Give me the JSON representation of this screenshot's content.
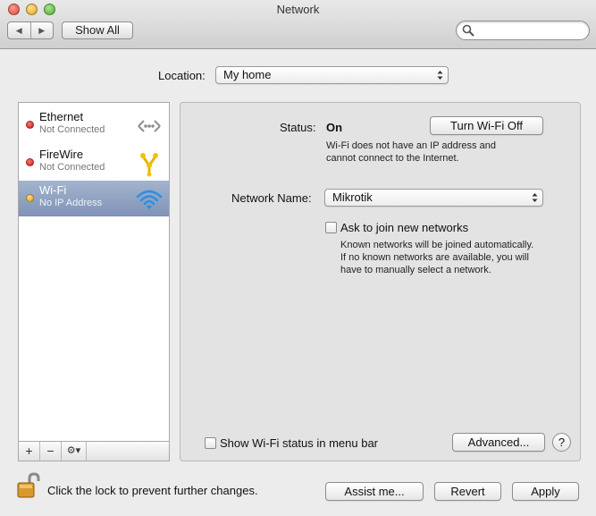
{
  "window": {
    "title": "Network"
  },
  "toolbar": {
    "back_glyph": "◀",
    "forward_glyph": "▶",
    "show_all_label": "Show All",
    "search_value": "",
    "search_placeholder": ""
  },
  "location": {
    "label": "Location:",
    "value": "My home"
  },
  "services": [
    {
      "name": "Ethernet",
      "status": "Not Connected",
      "icon": "ethernet-icon",
      "status_color": "#c8120a",
      "selected": false
    },
    {
      "name": "FireWire",
      "status": "Not Connected",
      "icon": "firewire-icon",
      "status_color": "#c8120a",
      "selected": false
    },
    {
      "name": "Wi-Fi",
      "status": "No IP Address",
      "icon": "wifi-icon",
      "status_color": "#e09a10",
      "selected": true
    }
  ],
  "list_footer": {
    "add": "+",
    "remove": "−",
    "gear": "⚙▾"
  },
  "detail": {
    "status_label": "Status:",
    "status_value": "On",
    "turn_off_label": "Turn Wi-Fi Off",
    "status_desc_1": "Wi-Fi does not have an IP address and",
    "status_desc_2": "cannot connect to the Internet.",
    "network_name_label": "Network Name:",
    "network_name_value": "Mikrotik",
    "ask_join_label": "Ask to join new networks",
    "ask_join_desc_1": "Known networks will be joined automatically.",
    "ask_join_desc_2": "If no known networks are available, you will",
    "ask_join_desc_3": "have to manually select a network.",
    "show_status_label": "Show Wi-Fi status in menu bar",
    "advanced_label": "Advanced...",
    "help_label": "?"
  },
  "bottom": {
    "lock_text": "Click the lock to prevent further changes.",
    "assist_label": "Assist me...",
    "revert_label": "Revert",
    "apply_label": "Apply"
  },
  "colors": {
    "selection": "#8a9cbd",
    "panel": "#e3e3e3",
    "window_bg": "#ececec"
  }
}
